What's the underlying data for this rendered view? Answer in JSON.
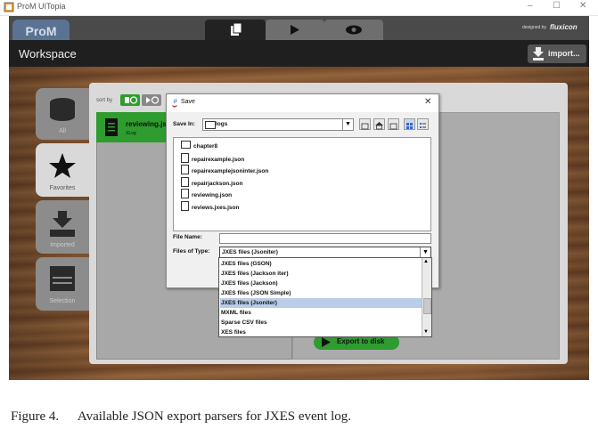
{
  "window": {
    "title": "ProM UITopia",
    "min": "–",
    "max": "☐",
    "close": "✕"
  },
  "header": {
    "logo": "ProM",
    "designed_by": "designed by",
    "brand": "fluxicon"
  },
  "workspace": {
    "title": "Workspace",
    "import_label": "import..."
  },
  "sidebar": {
    "items": [
      {
        "label": "All"
      },
      {
        "label": "Favorites"
      },
      {
        "label": "Imported"
      },
      {
        "label": "Selection"
      }
    ]
  },
  "logs": {
    "sort_label": "sort by",
    "item_name": "reviewing.js",
    "item_type": "XLog"
  },
  "export": {
    "label": "Export to disk"
  },
  "dialog": {
    "title": "Save",
    "save_in_label": "Save In:",
    "save_in_value": "logs",
    "files": [
      {
        "name": "chapter8",
        "kind": "folder"
      },
      {
        "name": "repairexample.json",
        "kind": "file"
      },
      {
        "name": "repairexamplejsoninter.json",
        "kind": "file"
      },
      {
        "name": "repairjackson.json",
        "kind": "file"
      },
      {
        "name": "reviewing.json",
        "kind": "file"
      },
      {
        "name": "reviews.jxes.json",
        "kind": "file"
      }
    ],
    "file_name_label": "File Name:",
    "file_name_value": "",
    "files_of_type_label": "Files of Type:",
    "files_of_type_value": "JXES files (Jsoniter)",
    "type_options": [
      "JXES files (GSON)",
      "JXES files (Jackson iter)",
      "JXES files (Jackson)",
      "JXES files (JSON Simple)",
      "JXES files (Jsoniter)",
      "MXML files",
      "Sparse CSV files",
      "XES files"
    ],
    "selected_option_index": 4
  },
  "caption": {
    "label": "Figure 4.",
    "text": "Available JSON export parsers for JXES event log."
  },
  "colors": {
    "accent_green": "#2e9c2e",
    "selection": "#b9cce8"
  }
}
